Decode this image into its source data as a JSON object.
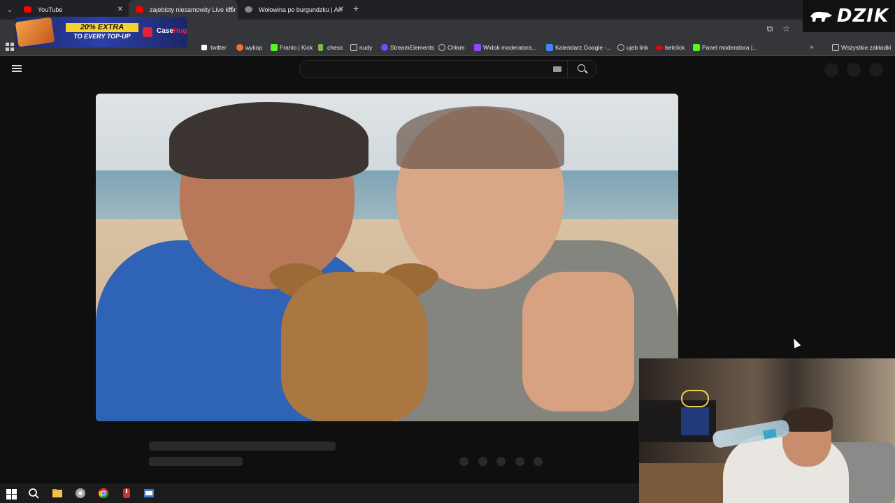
{
  "browser": {
    "tabs": [
      {
        "label": "YouTube",
        "favicon_color": "#ff0000",
        "active": false
      },
      {
        "label": "zajebisty niesamowity Live któr",
        "favicon_color": "#ff0000",
        "active": true
      },
      {
        "label": "Wołowina po burgundzku | An",
        "favicon_color": "#888888",
        "active": false
      }
    ],
    "new_tab_symbol": "+",
    "close_symbol": "✕",
    "bookmarks": [
      {
        "label": "twitter",
        "icon": "x-icon",
        "color": "#ffffff"
      },
      {
        "label": "wykop",
        "icon": "wykop-icon",
        "color": "#ff6a33"
      },
      {
        "label": "Franio | Kick",
        "icon": "kick-icon",
        "color": "#53fc18"
      },
      {
        "label": "chess",
        "icon": "pawn-icon",
        "color": "#81b64c"
      },
      {
        "label": "nudy",
        "icon": "folder-icon",
        "color": "#cccccc"
      },
      {
        "label": "StreamElements",
        "icon": "streamelements-icon",
        "color": "#6c4dff"
      },
      {
        "label": "Chłam",
        "icon": "globe-icon",
        "color": "#cccccc"
      },
      {
        "label": "Widok moderatora...",
        "icon": "twitch-icon",
        "color": "#9146ff"
      },
      {
        "label": "Kalendarz Google -...",
        "icon": "calendar-icon",
        "color": "#4285f4"
      },
      {
        "label": "ujeb link",
        "icon": "globe-icon",
        "color": "#cccccc"
      },
      {
        "label": "betclick",
        "icon": "betclic-icon",
        "color": "#e30613"
      },
      {
        "label": "Panel moderatora |...",
        "icon": "kick-icon",
        "color": "#53fc18"
      }
    ],
    "more_symbol": "»",
    "all_bookmarks": "Wszystkie zakładki"
  },
  "overlay": {
    "dzik_logo": "DZIK",
    "ad": {
      "line1": "20% EXTRA",
      "line2": "TO EVERY TOP-UP",
      "brand_a": "Case",
      "brand_b": "Hug"
    }
  },
  "colors": {
    "accent_red": "#ff0000",
    "background": "#0f0f0f"
  }
}
